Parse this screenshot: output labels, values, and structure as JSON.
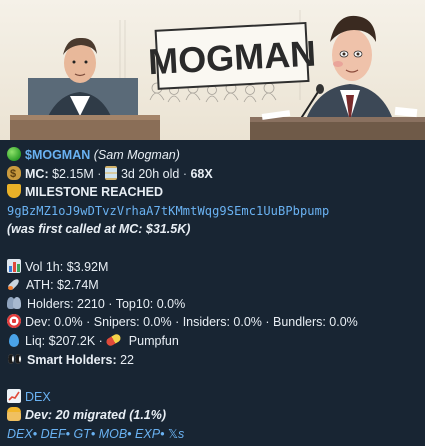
{
  "banner": {
    "sign_text": "MOGMAN"
  },
  "header": {
    "ticker": "$MOGMAN",
    "name": "(Sam Mogman)"
  },
  "mc_line": {
    "mc_label": "MC:",
    "mc_value": "$2.15M",
    "sep": "·",
    "age": "3d 20h old",
    "sep2": "·",
    "multiplier": "68X"
  },
  "milestone": "MILESTONE REACHED",
  "contract_address": "9gBzMZ1oJ9wDTvzVrhaA7tKMmtWqg9SEmc1UuBPbpump",
  "first_called": "(was first called at MC: $31.5K)",
  "stats": {
    "vol": "Vol 1h: $3.92M",
    "ath": "ATH: $2.74M",
    "holders": "Holders: 2210 · Top10: 0.0%",
    "dev": "Dev: 0.0% · Snipers: 0.0% · Insiders: 0.0% · Bundlers: 0.0%",
    "liq": "Liq: $207.2K · ",
    "launchpad": "Pumpfun",
    "smart_label": "Smart Holders:",
    "smart_value": "22"
  },
  "links": {
    "dex": "DEX",
    "dev_migrated": "Dev: 20 migrated (1.1%)",
    "footer": [
      "DEX",
      "DEF",
      "GT",
      "MOB",
      "EXP",
      "𝕏s"
    ],
    "footer_sep": "•"
  },
  "colors": {
    "background": "#182533",
    "text": "#e8eef4",
    "link": "#6ab2f2"
  },
  "icons": [
    "green-circle-icon",
    "money-bag-icon",
    "hourglass-icon",
    "trophy-icon",
    "bar-chart-icon",
    "rocket-icon",
    "people-icon",
    "target-icon",
    "droplet-icon",
    "pill-icon",
    "eyes-icon",
    "chart-increasing-icon",
    "worker-icon"
  ]
}
